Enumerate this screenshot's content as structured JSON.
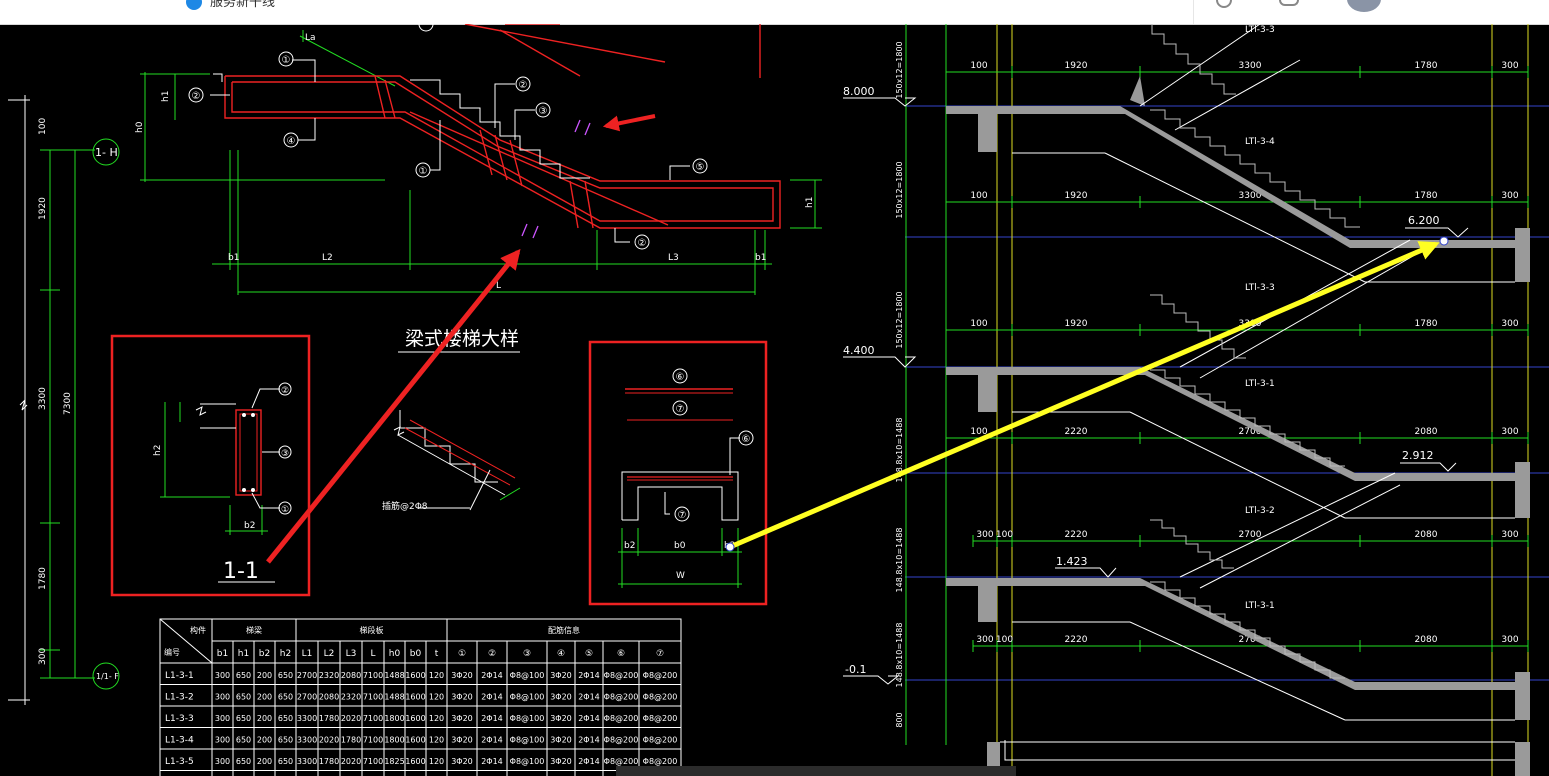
{
  "app": {
    "title": "服务新干线"
  },
  "drawing": {
    "detail_title": "梁式楼梯大样",
    "section_label": "1-1",
    "grid_axis_top": "1- H",
    "grid_axis_bottom": "1/1- F",
    "left_dims": [
      "300",
      "1780",
      "3300",
      "1920",
      "100",
      "7300"
    ],
    "upper_labels": [
      "La",
      "h1",
      "h0",
      "b1",
      "L2",
      "L",
      "L3",
      "b1",
      "h1"
    ],
    "bubbles": [
      "①",
      "②",
      "③",
      "④",
      "⑤",
      "⑥",
      "⑦"
    ],
    "section_marks": [
      "h1",
      "h2",
      "b2",
      "b2",
      "b0",
      "b2",
      "W"
    ],
    "stair_note": "插筋@2Φ8",
    "elev": {
      "e8000": "8.000",
      "e4400": "4.400",
      "e6200": "6.200",
      "e2912": "2.912",
      "e1423": "1.423",
      "em01": "-0.1"
    },
    "flight_labels": [
      "LTl-3-3",
      "LTl-3-4",
      "LTl-3-3",
      "LTl-3-1",
      "LTl-3-2",
      "LTl-3-1"
    ],
    "dim_rows": [
      [
        "100",
        "1920",
        "3300",
        "1780",
        "300"
      ],
      [
        "100",
        "1920",
        "3300",
        "1780",
        "300"
      ],
      [
        "100",
        "1920",
        "3300",
        "1780",
        "300"
      ],
      [
        "100",
        "2220",
        "2700",
        "2080",
        "300"
      ],
      [
        "300",
        "100",
        "2220",
        "2700",
        "2080",
        "300"
      ],
      [
        "300",
        "100",
        "2220",
        "2700",
        "2080",
        "300"
      ]
    ],
    "vert_dims": [
      "150x12=1800",
      "150x12=1800",
      "150x12=1800",
      "148.8x10=1488",
      "148.8x10=1488",
      "148.8x10=1488",
      "800"
    ],
    "table": {
      "corner_top": "构件",
      "corner_bottom": "编号",
      "group_headers": [
        "梯梁",
        "梯段板",
        "配筋信息"
      ],
      "col_headers": [
        "b1",
        "h1",
        "b2",
        "h2",
        "L1",
        "L2",
        "L3",
        "L",
        "h0",
        "b0",
        "t",
        "①",
        "②",
        "③",
        "④",
        "⑤",
        "⑥",
        "⑦"
      ],
      "rows": [
        [
          "L1-3-1",
          "300",
          "650",
          "200",
          "650",
          "2700",
          "2320",
          "2080",
          "7100",
          "1488",
          "1600",
          "120",
          "3Φ20",
          "2Φ14",
          "Φ8@100",
          "3Φ20",
          "2Φ14",
          "Φ8@200",
          "Φ8@200"
        ],
        [
          "L1-3-2",
          "300",
          "650",
          "200",
          "650",
          "2700",
          "2080",
          "2320",
          "7100",
          "1488",
          "1600",
          "120",
          "3Φ20",
          "2Φ14",
          "Φ8@100",
          "3Φ20",
          "2Φ14",
          "Φ8@200",
          "Φ8@200"
        ],
        [
          "L1-3-3",
          "300",
          "650",
          "200",
          "650",
          "3300",
          "1780",
          "2020",
          "7100",
          "1800",
          "1600",
          "120",
          "3Φ20",
          "2Φ14",
          "Φ8@100",
          "3Φ20",
          "2Φ14",
          "Φ8@200",
          "Φ8@200"
        ],
        [
          "L1-3-4",
          "300",
          "650",
          "200",
          "650",
          "3300",
          "2020",
          "1780",
          "7100",
          "1800",
          "1600",
          "120",
          "3Φ20",
          "2Φ14",
          "Φ8@100",
          "3Φ20",
          "2Φ14",
          "Φ8@200",
          "Φ8@200"
        ],
        [
          "L1-3-5",
          "300",
          "650",
          "200",
          "650",
          "3300",
          "1780",
          "2020",
          "7100",
          "1825",
          "1600",
          "120",
          "3Φ20",
          "2Φ14",
          "Φ8@100",
          "3Φ20",
          "2Φ14",
          "Φ8@200",
          "Φ8@200"
        ]
      ]
    }
  }
}
